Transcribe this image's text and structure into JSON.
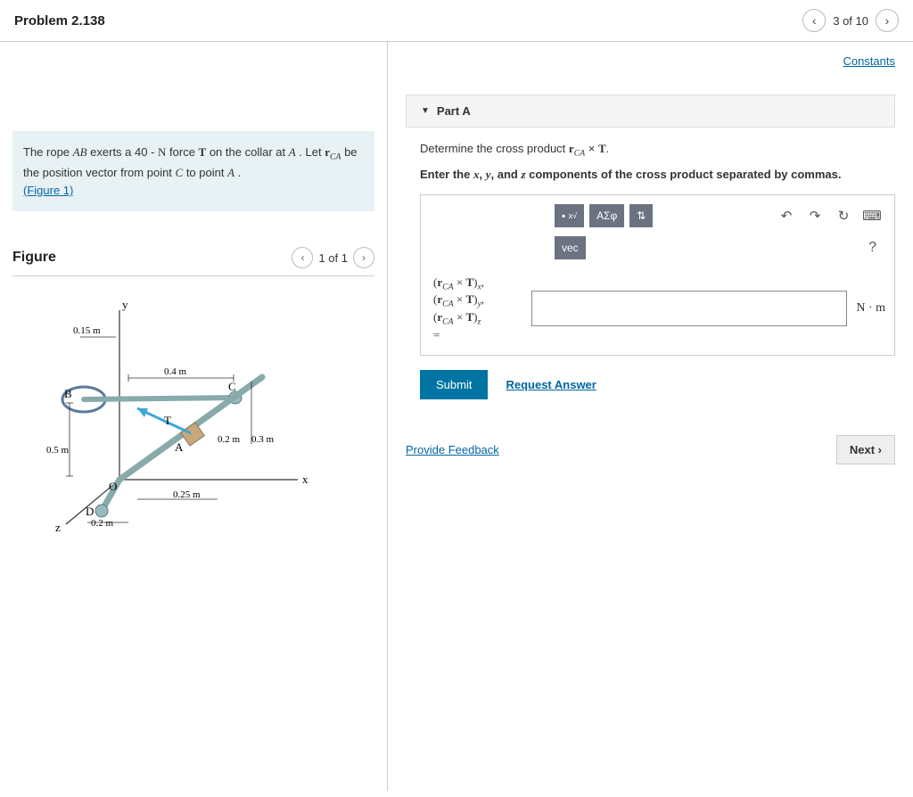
{
  "header": {
    "title": "Problem 2.138",
    "position": "3 of 10"
  },
  "constants_link": "Constants",
  "problem": {
    "text_pre": "The rope ",
    "AB": "AB",
    "text_mid1": " exerts a 40 - ",
    "N": "N",
    "text_mid2": " force ",
    "T": "T",
    "text_mid3": " on the collar at ",
    "A": "A",
    "text_mid4": " . Let ",
    "rCA": "r",
    "rCA_sub": "CA",
    "text_mid5": " be the position vector from point ",
    "C": "C",
    "text_mid6": " to point ",
    "A2": "A",
    "text_end": " . ",
    "figure_link": "(Figure 1)"
  },
  "figure": {
    "title": "Figure",
    "position": "1 of 1",
    "dims": {
      "d015": "0.15 m",
      "d04": "0.4 m",
      "d02a": "0.2 m",
      "d03": "0.3 m",
      "d05": "0.5 m",
      "d025": "0.25 m",
      "d02b": "0.2 m"
    },
    "labels": {
      "y": "y",
      "x": "x",
      "z": "z",
      "B": "B",
      "C": "C",
      "T": "T",
      "A": "A",
      "O": "O",
      "D": "D"
    }
  },
  "part": {
    "title": "Part A",
    "prompt_pre": "Determine the cross product ",
    "prompt_bold_pre": "Enter the ",
    "x": "x",
    "y": "y",
    "z": "z",
    "prompt_bold_mid": ", and ",
    "prompt_bold_end": " components of the cross product separated by commas.",
    "toolbar": {
      "greek": "ΑΣφ",
      "vec": "vec"
    },
    "lhs": {
      "line1": "(r",
      "sub": "CA",
      "times": " × T)",
      "sx": "x",
      "sy": "y",
      "sz": "z",
      "eq": "="
    },
    "unit": "N · m",
    "submit": "Submit",
    "request": "Request Answer"
  },
  "feedback": "Provide Feedback",
  "next": "Next"
}
